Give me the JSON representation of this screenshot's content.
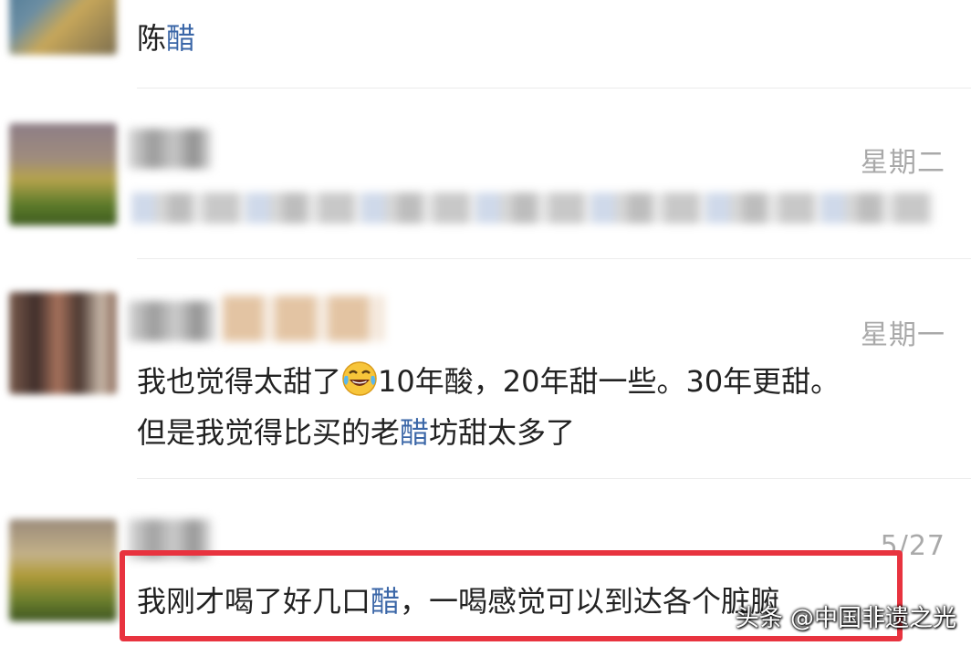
{
  "chat_list": {
    "items": [
      {
        "message_parts": [
          "陈",
          "醋"
        ]
      },
      {
        "time": "星期二"
      },
      {
        "time": "星期一",
        "line1_before": "我也觉得太甜了",
        "line1_emoji": "face-with-tears-of-joy-emoji",
        "line1_after": "10年酸，20年甜一些。30年更甜。",
        "line2_before": "但是我觉得比买的老",
        "line2_highlight": "醋",
        "line2_after": "坊甜太多了"
      },
      {
        "time": "5/27",
        "message_before": "我刚才喝了好几口",
        "message_highlight": "醋",
        "message_after": "，一喝感觉可以到达各个脏腑"
      }
    ]
  },
  "watermark": "头条 @中国非遗之光",
  "colors": {
    "keyword_highlight": "#3a66a7",
    "annotation_box": "#e8333f",
    "time_text": "#a9a9a9"
  }
}
